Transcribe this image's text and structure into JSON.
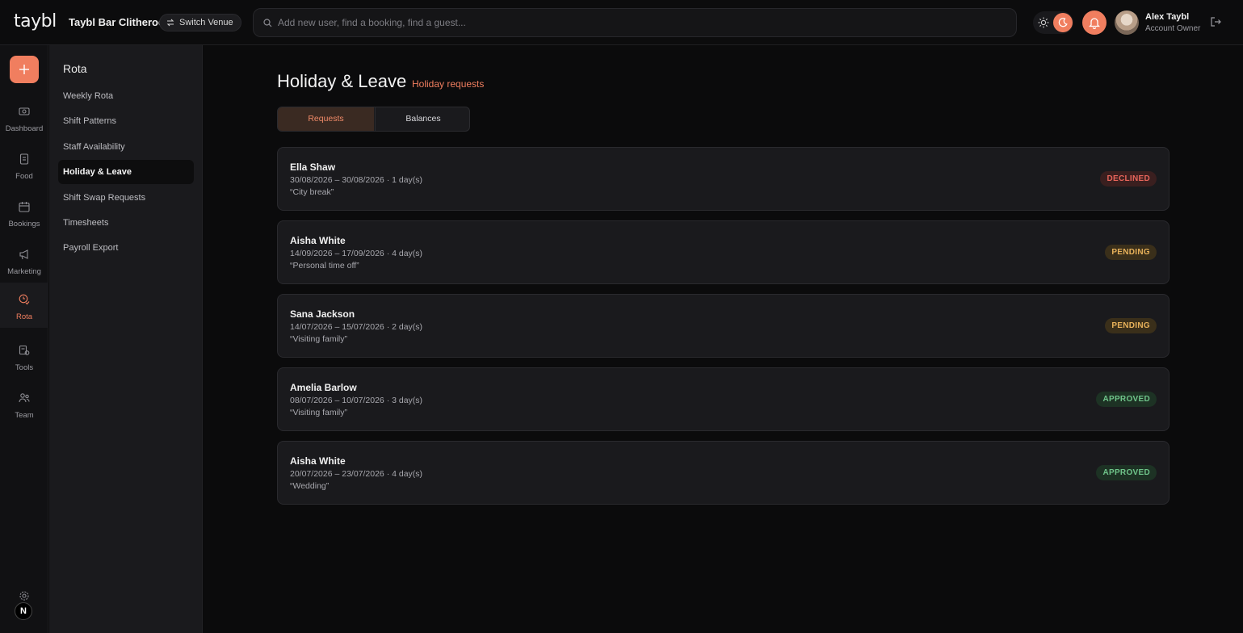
{
  "topbar": {
    "logo": "taybl",
    "venue_name": "Taybl Bar Clitheroe",
    "switch_venue": "Switch Venue",
    "search_placeholder": "Add new user, find a booking, find a guest...",
    "user_name": "Alex Taybl",
    "user_role": "Account Owner",
    "accent": "#f07e5f"
  },
  "rail": {
    "items": [
      {
        "label": "Dashboard",
        "icon": "dashboard-icon"
      },
      {
        "label": "Food",
        "icon": "food-icon"
      },
      {
        "label": "Bookings",
        "icon": "bookings-icon"
      },
      {
        "label": "Marketing",
        "icon": "megaphone-icon"
      },
      {
        "label": "Rota",
        "icon": "rota-icon",
        "active": true
      },
      {
        "label": "Tools",
        "icon": "tools-icon"
      },
      {
        "label": "Team",
        "icon": "team-icon"
      }
    ],
    "badge": "N"
  },
  "subnav": {
    "title": "Rota",
    "items": [
      "Weekly Rota",
      "Shift Patterns",
      "Staff Availability",
      "Holiday & Leave",
      "Shift Swap Requests",
      "Timesheets",
      "Payroll Export"
    ],
    "active": "Holiday & Leave"
  },
  "main": {
    "title": "Holiday & Leave",
    "subtitle": "Holiday requests",
    "tabs": [
      "Requests",
      "Balances"
    ],
    "active_tab": "Requests",
    "requests": [
      {
        "name": "Ella Shaw",
        "dates": "30/08/2026 – 30/08/2026 · 1 day(s)",
        "note": "“City break”",
        "status": "DECLINED"
      },
      {
        "name": "Aisha White",
        "dates": "14/09/2026 – 17/09/2026 · 4 day(s)",
        "note": "“Personal time off”",
        "status": "PENDING"
      },
      {
        "name": "Sana Jackson",
        "dates": "14/07/2026 – 15/07/2026 · 2 day(s)",
        "note": "“Visiting family”",
        "status": "PENDING"
      },
      {
        "name": "Amelia Barlow",
        "dates": "08/07/2026 – 10/07/2026 · 3 day(s)",
        "note": "“Visiting family”",
        "status": "APPROVED"
      },
      {
        "name": "Aisha White",
        "dates": "20/07/2026 – 23/07/2026 · 4 day(s)",
        "note": "“Wedding”",
        "status": "APPROVED"
      }
    ]
  }
}
